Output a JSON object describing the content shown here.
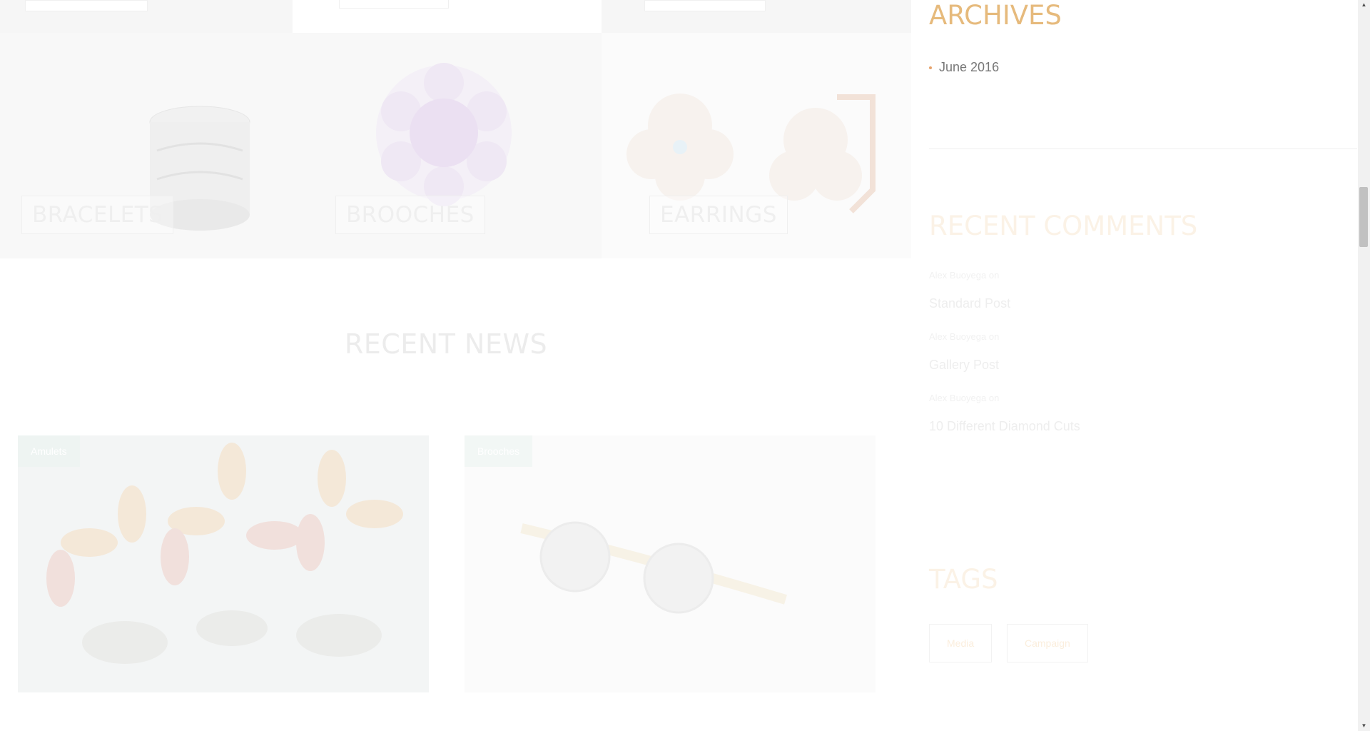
{
  "categories": {
    "items": [
      {
        "label": "BRACELETS"
      },
      {
        "label": "BROOCHES"
      },
      {
        "label": "EARRINGS"
      }
    ]
  },
  "recent_news": {
    "title": "RECENT NEWS",
    "posts": [
      {
        "category": "Amulets"
      },
      {
        "category": "Brooches"
      }
    ]
  },
  "sidebar": {
    "archives": {
      "title": "ARCHIVES",
      "items": [
        "June 2016"
      ]
    },
    "recent_comments": {
      "title": "RECENT COMMENTS",
      "items": [
        {
          "author": "Alex Buoyega",
          "on": "on",
          "post": "Standard Post"
        },
        {
          "author": "Alex Buoyega",
          "on": "on",
          "post": "Gallery Post"
        },
        {
          "author": "Alex Buoyega",
          "on": "on",
          "post": "10 Different Diamond Cuts"
        }
      ]
    },
    "tags": {
      "title": "TAGS",
      "items": [
        "Media",
        "Campaign"
      ]
    }
  },
  "colors": {
    "accent": "#e6ba7c",
    "bullet": "#e6a36d"
  }
}
